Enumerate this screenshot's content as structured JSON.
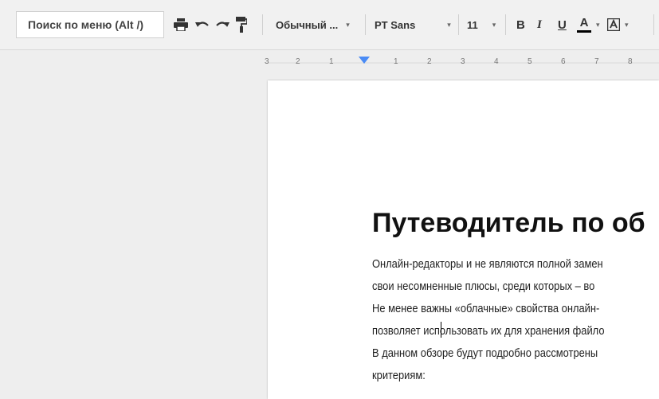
{
  "toolbar": {
    "menu_search_placeholder": "Поиск по меню (Alt /)",
    "paragraph_style": "Обычный ...",
    "font_name": "PT Sans",
    "font_size": "11",
    "bold": "B",
    "italic": "I",
    "underline": "U",
    "text_color": "A",
    "highlight_icon": "highlight-icon",
    "caret": "▾"
  },
  "ruler": {
    "labels": [
      "3",
      "2",
      "1",
      "1",
      "2",
      "3",
      "4",
      "5",
      "6",
      "7",
      "8"
    ]
  },
  "document": {
    "title": "Путеводитель по об",
    "lines": [
      "Онлайн-редакторы и не являются полной замен",
      "свои несомненные плюсы, среди которых – во",
      "Не менее важны «облачные» свойства онлайн-",
      "позволяет использовать их для хранения файло",
      "В данном обзоре будут подробно рассмотрены",
      "критериям:"
    ]
  },
  "colors": {
    "ruler_marker": "#4a8bf5",
    "page_bg": "#ffffff",
    "app_bg": "#eeeeee"
  }
}
